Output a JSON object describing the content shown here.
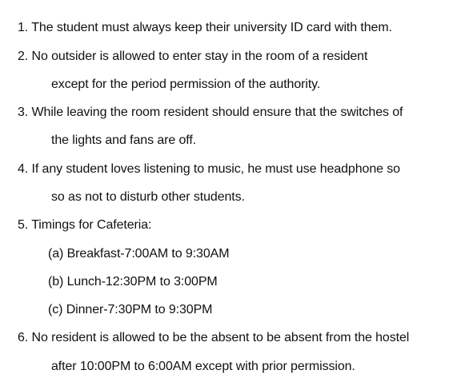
{
  "document": {
    "rules": [
      {
        "number": "1.",
        "text": "The student must always keep their university ID card with them.",
        "continuation": ""
      },
      {
        "number": "2.",
        "text": "No outsider is allowed to enter stay in the room of a resident",
        "continuation": "except for the period permission of the authority."
      },
      {
        "number": "3.",
        "text": "While leaving the room resident should ensure that the switches of",
        "continuation": "the lights and fans are off."
      },
      {
        "number": "4.",
        "text": "If any student loves listening to music, he must use headphone so",
        "continuation": "so as not to disturb other students."
      },
      {
        "number": "5.",
        "text": "Timings for Cafeteria:",
        "continuation": "",
        "subitems": [
          "(a) Breakfast-7:00AM to 9:30AM",
          "(b) Lunch-12:30PM to 3:00PM",
          "(c) Dinner-7:30PM to 9:30PM"
        ]
      },
      {
        "number": "6.",
        "text": "No resident is allowed to be the absent to be absent from the hostel",
        "continuation": "after 10:00PM to 6:00AM except with prior permission."
      }
    ]
  }
}
